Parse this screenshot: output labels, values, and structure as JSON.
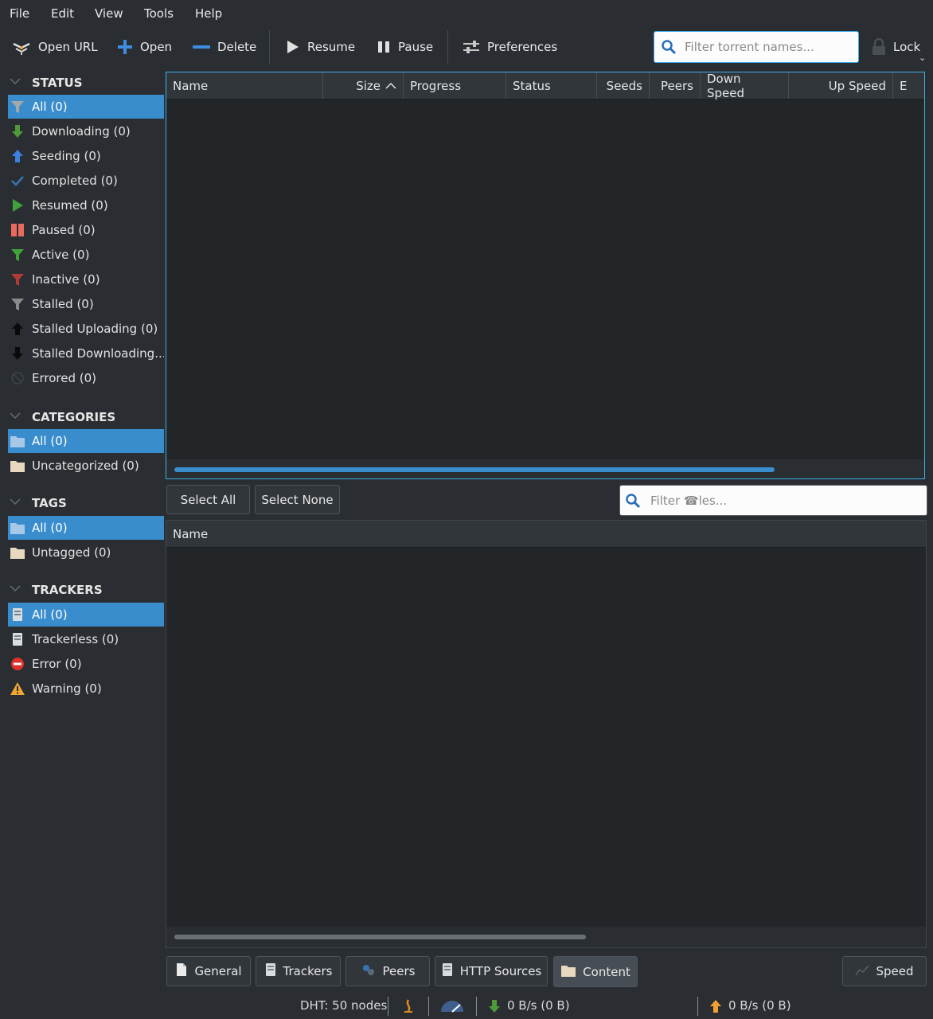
{
  "menubar": {
    "items": [
      "File",
      "Edit",
      "View",
      "Tools",
      "Help"
    ]
  },
  "toolbar": {
    "open_url": "Open URL",
    "open": "Open",
    "delete": "Delete",
    "resume": "Resume",
    "pause": "Pause",
    "preferences": "Preferences",
    "search_placeholder": "Filter torrent names...",
    "lock": "Lock"
  },
  "sidebar": {
    "status_header": "STATUS",
    "status_items": [
      "All (0)",
      "Downloading (0)",
      "Seeding (0)",
      "Completed (0)",
      "Resumed (0)",
      "Paused (0)",
      "Active (0)",
      "Inactive (0)",
      "Stalled (0)",
      "Stalled Uploading (0)",
      "Stalled Downloading...",
      "Errored (0)"
    ],
    "categories_header": "CATEGORIES",
    "categories_items": [
      "All (0)",
      "Uncategorized (0)"
    ],
    "tags_header": "TAGS",
    "tags_items": [
      "All (0)",
      "Untagged (0)"
    ],
    "trackers_header": "TRACKERS",
    "trackers_items": [
      "All (0)",
      "Trackerless (0)",
      "Error (0)",
      "Warning (0)"
    ]
  },
  "torrent_table": {
    "columns": [
      "Name",
      "Size",
      "Progress",
      "Status",
      "Seeds",
      "Peers",
      "Down Speed",
      "Up Speed",
      "E"
    ]
  },
  "content": {
    "select_all": "Select All",
    "select_none": "Select None",
    "filter_placeholder": "Filter ☎les...",
    "file_column": "Name"
  },
  "tabs": {
    "general": "General",
    "trackers": "Trackers",
    "peers": "Peers",
    "http_sources": "HTTP Sources",
    "content": "Content",
    "speed": "Speed"
  },
  "statusbar": {
    "dht": "DHT: 50 nodes",
    "down": "0 B/s (0 B)",
    "up": "0 B/s (0 B)"
  },
  "colors": {
    "accent": "#3daee9",
    "selection": "#3a8dcc",
    "background": "#2a2e32",
    "table_bg": "#232629"
  }
}
